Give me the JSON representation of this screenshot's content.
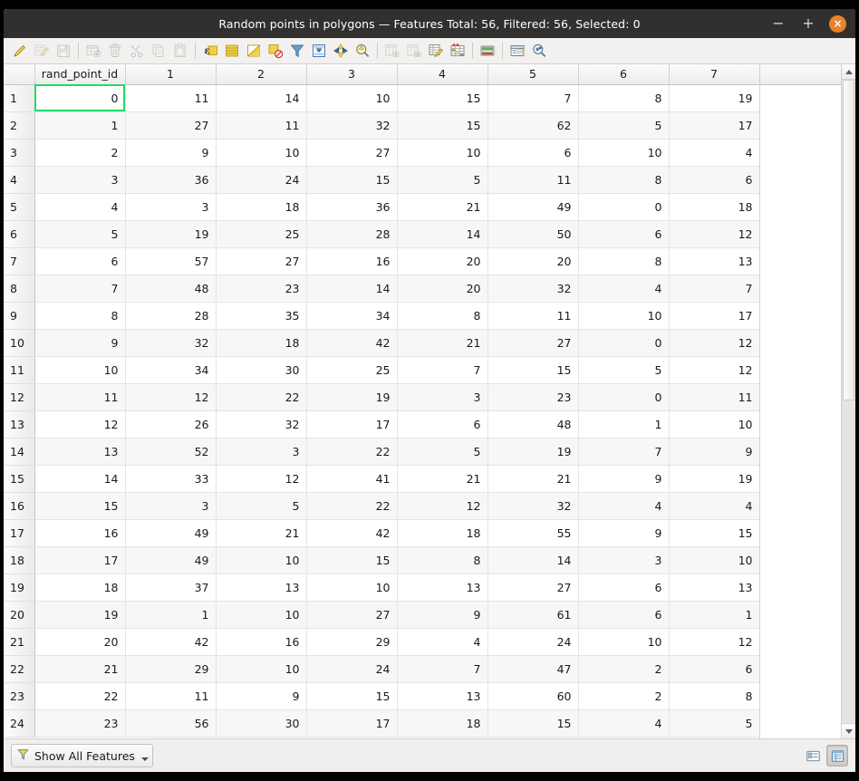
{
  "window": {
    "title": "Random points in polygons — Features Total: 56, Filtered: 56, Selected: 0",
    "controls": {
      "minimize": "−",
      "maximize": "+",
      "close": "×"
    }
  },
  "toolbar": {
    "items": [
      {
        "name": "toggle-editing-icon",
        "tip": "Toggle editing mode",
        "enabled": true
      },
      {
        "name": "multi-edit-icon",
        "tip": "Toggle multi edit mode",
        "enabled": false
      },
      {
        "name": "save-edits-icon",
        "tip": "Save edits",
        "enabled": false
      },
      {
        "name": "separator",
        "tip": "",
        "enabled": true
      },
      {
        "name": "add-feature-icon",
        "tip": "Add feature",
        "enabled": false
      },
      {
        "name": "delete-selected-icon",
        "tip": "Delete selected features",
        "enabled": false
      },
      {
        "name": "cut-features-icon",
        "tip": "Cut features",
        "enabled": false
      },
      {
        "name": "copy-features-icon",
        "tip": "Copy features",
        "enabled": false
      },
      {
        "name": "paste-features-icon",
        "tip": "Paste features",
        "enabled": false
      },
      {
        "name": "separator",
        "tip": "",
        "enabled": true
      },
      {
        "name": "select-by-expression-icon",
        "tip": "Select features using an expression",
        "enabled": true
      },
      {
        "name": "select-all-icon",
        "tip": "Select all features",
        "enabled": true
      },
      {
        "name": "invert-selection-icon",
        "tip": "Invert selection",
        "enabled": true
      },
      {
        "name": "deselect-all-icon",
        "tip": "Deselect all features",
        "enabled": true
      },
      {
        "name": "filter-selection-icon",
        "tip": "Filter / select features",
        "enabled": true
      },
      {
        "name": "move-selection-to-top-icon",
        "tip": "Move selection to top",
        "enabled": true
      },
      {
        "name": "pan-map-to-selection-icon",
        "tip": "Pan map to selected rows",
        "enabled": true
      },
      {
        "name": "zoom-map-to-selection-icon",
        "tip": "Zoom map to selected rows",
        "enabled": true
      },
      {
        "name": "separator",
        "tip": "",
        "enabled": true
      },
      {
        "name": "new-field-icon",
        "tip": "New field",
        "enabled": false
      },
      {
        "name": "delete-field-icon",
        "tip": "Delete field",
        "enabled": false
      },
      {
        "name": "open-field-calculator-icon",
        "tip": "Open field calculator",
        "enabled": true
      },
      {
        "name": "conditional-formatting-icon",
        "tip": "Conditional formatting",
        "enabled": true
      },
      {
        "name": "separator",
        "tip": "",
        "enabled": true
      },
      {
        "name": "organize-columns-icon",
        "tip": "Organize columns",
        "enabled": true
      },
      {
        "name": "separator",
        "tip": "",
        "enabled": true
      },
      {
        "name": "form-view-icon",
        "tip": "Switch to form view",
        "enabled": true
      },
      {
        "name": "actions-icon",
        "tip": "Actions",
        "enabled": true
      }
    ]
  },
  "table": {
    "columns": [
      "rand_point_id",
      "1",
      "2",
      "3",
      "4",
      "5",
      "6",
      "7"
    ],
    "row_numbers": [
      1,
      2,
      3,
      4,
      5,
      6,
      7,
      8,
      9,
      10,
      11,
      12,
      13,
      14,
      15,
      16,
      17,
      18,
      19,
      20,
      21,
      22,
      23,
      24
    ],
    "selected_cell": {
      "row": 0,
      "col": 0
    },
    "rows": [
      [
        0,
        11,
        14,
        10,
        15,
        7,
        8,
        19
      ],
      [
        1,
        27,
        11,
        32,
        15,
        62,
        5,
        17
      ],
      [
        2,
        9,
        10,
        27,
        10,
        6,
        10,
        4
      ],
      [
        3,
        36,
        24,
        15,
        5,
        11,
        8,
        6
      ],
      [
        4,
        3,
        18,
        36,
        21,
        49,
        0,
        18
      ],
      [
        5,
        19,
        25,
        28,
        14,
        50,
        6,
        12
      ],
      [
        6,
        57,
        27,
        16,
        20,
        20,
        8,
        13
      ],
      [
        7,
        48,
        23,
        14,
        20,
        32,
        4,
        7
      ],
      [
        8,
        28,
        35,
        34,
        8,
        11,
        10,
        17
      ],
      [
        9,
        32,
        18,
        42,
        21,
        27,
        0,
        12
      ],
      [
        10,
        34,
        30,
        25,
        7,
        15,
        5,
        12
      ],
      [
        11,
        12,
        22,
        19,
        3,
        23,
        0,
        11
      ],
      [
        12,
        26,
        32,
        17,
        6,
        48,
        1,
        10
      ],
      [
        13,
        52,
        3,
        22,
        5,
        19,
        7,
        9
      ],
      [
        14,
        33,
        12,
        41,
        21,
        21,
        9,
        19
      ],
      [
        15,
        3,
        5,
        22,
        12,
        32,
        4,
        4
      ],
      [
        16,
        49,
        21,
        42,
        18,
        55,
        9,
        15
      ],
      [
        17,
        49,
        10,
        15,
        8,
        14,
        3,
        10
      ],
      [
        18,
        37,
        13,
        10,
        13,
        27,
        6,
        13
      ],
      [
        19,
        1,
        10,
        27,
        9,
        61,
        6,
        1
      ],
      [
        20,
        42,
        16,
        29,
        4,
        24,
        10,
        12
      ],
      [
        21,
        29,
        10,
        24,
        7,
        47,
        2,
        6
      ],
      [
        22,
        11,
        9,
        15,
        13,
        60,
        2,
        8
      ],
      [
        23,
        56,
        30,
        17,
        18,
        15,
        4,
        5
      ]
    ]
  },
  "statusbar": {
    "filter_label": "Show All Features",
    "filter_icon": "funnel-icon",
    "view_form_label": "form-view",
    "view_table_label": "table-view"
  },
  "colors": {
    "titlebar_bg": "#31302f",
    "close_button": "#e8832a",
    "selection_outline": "#22d96a",
    "selection_fill": "#e4f0f7",
    "alt_row": "#f7f7f6",
    "accent_yellow": "#f2d14a",
    "accent_blue": "#3a6ea5"
  }
}
